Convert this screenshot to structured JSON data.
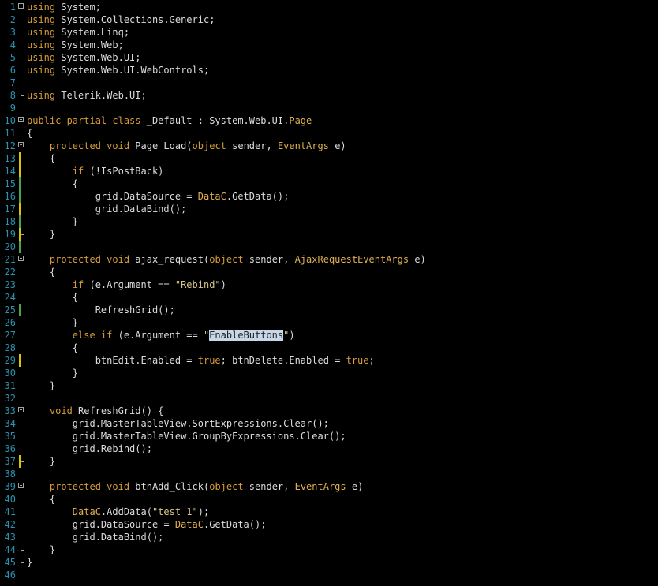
{
  "editor": {
    "lines": [
      {
        "num": "1",
        "fold": "box",
        "change": "",
        "tokens": [
          {
            "t": "kw",
            "v": "using"
          },
          {
            "t": "",
            "v": " System;"
          }
        ]
      },
      {
        "num": "2",
        "fold": "line",
        "change": "",
        "tokens": [
          {
            "t": "kw",
            "v": "using"
          },
          {
            "t": "",
            "v": " System.Collections.Generic;"
          }
        ]
      },
      {
        "num": "3",
        "fold": "line",
        "change": "",
        "tokens": [
          {
            "t": "kw",
            "v": "using"
          },
          {
            "t": "",
            "v": " System.Linq;"
          }
        ]
      },
      {
        "num": "4",
        "fold": "line",
        "change": "",
        "tokens": [
          {
            "t": "kw",
            "v": "using"
          },
          {
            "t": "",
            "v": " System.Web;"
          }
        ]
      },
      {
        "num": "5",
        "fold": "line",
        "change": "",
        "tokens": [
          {
            "t": "kw",
            "v": "using"
          },
          {
            "t": "",
            "v": " System.Web.UI;"
          }
        ]
      },
      {
        "num": "6",
        "fold": "line",
        "change": "",
        "tokens": [
          {
            "t": "kw",
            "v": "using"
          },
          {
            "t": "",
            "v": " System.Web.UI.WebControls;"
          }
        ]
      },
      {
        "num": "7",
        "fold": "line",
        "change": "",
        "tokens": []
      },
      {
        "num": "8",
        "fold": "end",
        "change": "",
        "tokens": [
          {
            "t": "kw",
            "v": "using"
          },
          {
            "t": "",
            "v": " Telerik.Web.UI;"
          }
        ]
      },
      {
        "num": "9",
        "fold": "",
        "change": "",
        "tokens": []
      },
      {
        "num": "10",
        "fold": "box",
        "change": "",
        "tokens": [
          {
            "t": "kw",
            "v": "public partial class"
          },
          {
            "t": "",
            "v": " _Default : System.Web.UI."
          },
          {
            "t": "cls",
            "v": "Page"
          }
        ]
      },
      {
        "num": "11",
        "fold": "line",
        "change": "",
        "tokens": [
          {
            "t": "",
            "v": "{"
          }
        ]
      },
      {
        "num": "12",
        "fold": "box",
        "change": "",
        "tokens": [
          {
            "t": "",
            "v": "    "
          },
          {
            "t": "kw",
            "v": "protected void"
          },
          {
            "t": "",
            "v": " Page_Load("
          },
          {
            "t": "kw",
            "v": "object"
          },
          {
            "t": "",
            "v": " sender, "
          },
          {
            "t": "cls",
            "v": "EventArgs"
          },
          {
            "t": "",
            "v": " e)"
          }
        ]
      },
      {
        "num": "13",
        "fold": "line",
        "change": "yellow",
        "tokens": [
          {
            "t": "",
            "v": "    {"
          }
        ]
      },
      {
        "num": "14",
        "fold": "line",
        "change": "yellow",
        "tokens": [
          {
            "t": "",
            "v": "        "
          },
          {
            "t": "kw",
            "v": "if"
          },
          {
            "t": "",
            "v": " (!IsPostBack)"
          }
        ]
      },
      {
        "num": "15",
        "fold": "line",
        "change": "green",
        "tokens": [
          {
            "t": "",
            "v": "        {"
          }
        ]
      },
      {
        "num": "16",
        "fold": "line",
        "change": "green",
        "tokens": [
          {
            "t": "",
            "v": "            grid.DataSource = "
          },
          {
            "t": "cls",
            "v": "DataC"
          },
          {
            "t": "",
            "v": ".GetData();"
          }
        ]
      },
      {
        "num": "17",
        "fold": "line",
        "change": "yellow",
        "tokens": [
          {
            "t": "",
            "v": "            grid.DataBind();"
          }
        ]
      },
      {
        "num": "18",
        "fold": "line",
        "change": "green",
        "tokens": [
          {
            "t": "",
            "v": "        }"
          }
        ]
      },
      {
        "num": "19",
        "fold": "end",
        "change": "yellow",
        "tokens": [
          {
            "t": "",
            "v": "    }"
          }
        ]
      },
      {
        "num": "20",
        "fold": "line",
        "change": "green",
        "tokens": []
      },
      {
        "num": "21",
        "fold": "box",
        "change": "",
        "tokens": [
          {
            "t": "",
            "v": "    "
          },
          {
            "t": "kw",
            "v": "protected void"
          },
          {
            "t": "",
            "v": " ajax_request("
          },
          {
            "t": "kw",
            "v": "object"
          },
          {
            "t": "",
            "v": " sender, "
          },
          {
            "t": "cls",
            "v": "AjaxRequestEventArgs"
          },
          {
            "t": "",
            "v": " e)"
          }
        ]
      },
      {
        "num": "22",
        "fold": "line",
        "change": "",
        "tokens": [
          {
            "t": "",
            "v": "    {"
          }
        ]
      },
      {
        "num": "23",
        "fold": "line",
        "change": "",
        "tokens": [
          {
            "t": "",
            "v": "        "
          },
          {
            "t": "kw",
            "v": "if"
          },
          {
            "t": "",
            "v": " (e.Argument == "
          },
          {
            "t": "str",
            "v": "\"Rebind\""
          },
          {
            "t": "",
            "v": ")"
          }
        ]
      },
      {
        "num": "24",
        "fold": "line",
        "change": "",
        "tokens": [
          {
            "t": "",
            "v": "        {"
          }
        ]
      },
      {
        "num": "25",
        "fold": "line",
        "change": "green",
        "tokens": [
          {
            "t": "",
            "v": "            RefreshGrid();"
          }
        ]
      },
      {
        "num": "26",
        "fold": "line",
        "change": "",
        "tokens": [
          {
            "t": "",
            "v": "        }"
          }
        ]
      },
      {
        "num": "27",
        "fold": "line",
        "change": "",
        "tokens": [
          {
            "t": "",
            "v": "        "
          },
          {
            "t": "kw",
            "v": "else if"
          },
          {
            "t": "",
            "v": " (e.Argument == "
          },
          {
            "t": "str",
            "v": "\""
          },
          {
            "t": "sel",
            "v": "EnableButtons"
          },
          {
            "t": "str",
            "v": "\""
          },
          {
            "t": "",
            "v": ")"
          }
        ]
      },
      {
        "num": "28",
        "fold": "line",
        "change": "",
        "tokens": [
          {
            "t": "",
            "v": "        {"
          }
        ]
      },
      {
        "num": "29",
        "fold": "line",
        "change": "yellow",
        "tokens": [
          {
            "t": "",
            "v": "            btnEdit.Enabled = "
          },
          {
            "t": "kw",
            "v": "true"
          },
          {
            "t": "",
            "v": "; btnDelete.Enabled = "
          },
          {
            "t": "kw",
            "v": "true"
          },
          {
            "t": "",
            "v": ";"
          }
        ]
      },
      {
        "num": "30",
        "fold": "line",
        "change": "",
        "tokens": [
          {
            "t": "",
            "v": "        }"
          }
        ]
      },
      {
        "num": "31",
        "fold": "end",
        "change": "",
        "tokens": [
          {
            "t": "",
            "v": "    }"
          }
        ]
      },
      {
        "num": "32",
        "fold": "line",
        "change": "",
        "tokens": []
      },
      {
        "num": "33",
        "fold": "box",
        "change": "",
        "tokens": [
          {
            "t": "",
            "v": "    "
          },
          {
            "t": "kw",
            "v": "void"
          },
          {
            "t": "",
            "v": " RefreshGrid() {"
          }
        ]
      },
      {
        "num": "34",
        "fold": "line",
        "change": "",
        "tokens": [
          {
            "t": "",
            "v": "        grid.MasterTableView.SortExpressions.Clear();"
          }
        ]
      },
      {
        "num": "35",
        "fold": "line",
        "change": "",
        "tokens": [
          {
            "t": "",
            "v": "        grid.MasterTableView.GroupByExpressions.Clear();"
          }
        ]
      },
      {
        "num": "36",
        "fold": "line",
        "change": "",
        "tokens": [
          {
            "t": "",
            "v": "        grid.Rebind();"
          }
        ]
      },
      {
        "num": "37",
        "fold": "end",
        "change": "yellow",
        "tokens": [
          {
            "t": "",
            "v": "    }"
          }
        ]
      },
      {
        "num": "38",
        "fold": "line",
        "change": "",
        "tokens": []
      },
      {
        "num": "39",
        "fold": "box",
        "change": "",
        "tokens": [
          {
            "t": "",
            "v": "    "
          },
          {
            "t": "kw",
            "v": "protected void"
          },
          {
            "t": "",
            "v": " btnAdd_Click("
          },
          {
            "t": "kw",
            "v": "object"
          },
          {
            "t": "",
            "v": " sender, "
          },
          {
            "t": "cls",
            "v": "EventArgs"
          },
          {
            "t": "",
            "v": " e)"
          }
        ]
      },
      {
        "num": "40",
        "fold": "line",
        "change": "",
        "tokens": [
          {
            "t": "",
            "v": "    {"
          }
        ]
      },
      {
        "num": "41",
        "fold": "line",
        "change": "",
        "tokens": [
          {
            "t": "",
            "v": "        "
          },
          {
            "t": "cls",
            "v": "DataC"
          },
          {
            "t": "",
            "v": ".AddData("
          },
          {
            "t": "str",
            "v": "\"test 1\""
          },
          {
            "t": "",
            "v": ");"
          }
        ]
      },
      {
        "num": "42",
        "fold": "line",
        "change": "",
        "tokens": [
          {
            "t": "",
            "v": "        grid.DataSource = "
          },
          {
            "t": "cls",
            "v": "DataC"
          },
          {
            "t": "",
            "v": ".GetData();"
          }
        ]
      },
      {
        "num": "43",
        "fold": "line",
        "change": "",
        "tokens": [
          {
            "t": "",
            "v": "        grid.DataBind();"
          }
        ]
      },
      {
        "num": "44",
        "fold": "end",
        "change": "",
        "tokens": [
          {
            "t": "",
            "v": "    }"
          }
        ]
      },
      {
        "num": "45",
        "fold": "end",
        "change": "",
        "tokens": [
          {
            "t": "",
            "v": "}"
          }
        ]
      },
      {
        "num": "46",
        "fold": "",
        "change": "",
        "tokens": []
      }
    ]
  }
}
